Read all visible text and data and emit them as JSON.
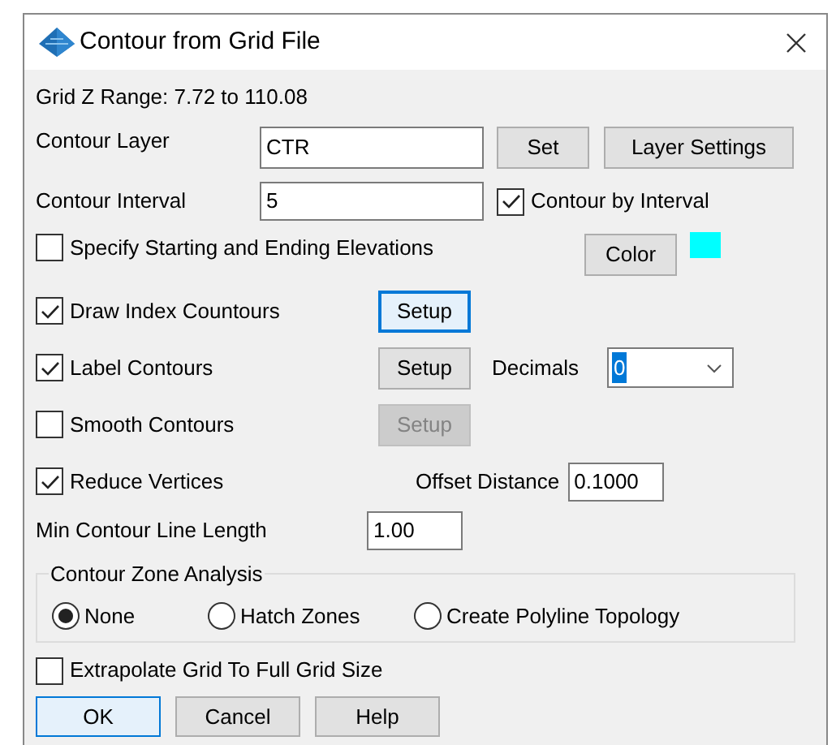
{
  "window": {
    "title": "Contour from Grid File"
  },
  "grid_z_range": "Grid Z Range: 7.72 to 110.08",
  "contour_layer": {
    "label": "Contour Layer",
    "value": "CTR",
    "set_button": "Set",
    "settings_button": "Layer Settings"
  },
  "contour_interval": {
    "label": "Contour Interval",
    "value": "5",
    "by_interval": {
      "label": "Contour by Interval",
      "checked": true
    }
  },
  "specify_elevations": {
    "label": "Specify Starting and Ending Elevations",
    "checked": false,
    "color_button": "Color",
    "color": "#00ffff"
  },
  "options": [
    {
      "label": "Draw Index Countours",
      "checked": true,
      "setup": {
        "label": "Setup",
        "focused": true,
        "disabled": false
      }
    },
    {
      "label": "Label Contours",
      "checked": true,
      "setup": {
        "label": "Setup",
        "focused": false,
        "disabled": false
      },
      "decimals": {
        "label": "Decimals",
        "value": "0"
      }
    },
    {
      "label": "Smooth Contours",
      "checked": false,
      "setup": {
        "label": "Setup",
        "focused": false,
        "disabled": true
      }
    },
    {
      "label": "Reduce Vertices",
      "checked": true,
      "offset": {
        "label": "Offset Distance",
        "value": "0.1000"
      }
    }
  ],
  "min_length": {
    "label": "Min Contour Line Length",
    "value": "1.00"
  },
  "zone_analysis": {
    "title": "Contour Zone Analysis",
    "options": [
      {
        "label": "None",
        "selected": true
      },
      {
        "label": "Hatch Zones",
        "selected": false
      },
      {
        "label": "Create Polyline Topology",
        "selected": false
      }
    ]
  },
  "extrapolate": {
    "label": "Extrapolate Grid To Full Grid Size",
    "checked": false
  },
  "buttons": [
    {
      "label": "OK",
      "default": true
    },
    {
      "label": "Cancel",
      "default": false
    },
    {
      "label": "Help",
      "default": false
    }
  ]
}
